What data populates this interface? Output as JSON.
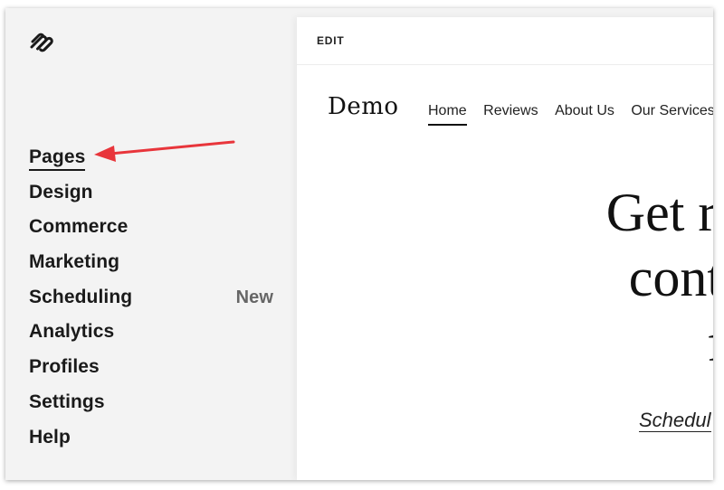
{
  "sidebar": {
    "logo_icon": "squarespace-logo-icon",
    "items": [
      {
        "label": "Pages",
        "active": true
      },
      {
        "label": "Design"
      },
      {
        "label": "Commerce"
      },
      {
        "label": "Marketing"
      },
      {
        "label": "Scheduling",
        "badge": "New"
      },
      {
        "label": "Analytics"
      },
      {
        "label": "Profiles"
      },
      {
        "label": "Settings"
      },
      {
        "label": "Help"
      }
    ]
  },
  "annotation": {
    "arrow_color": "#e8353b"
  },
  "preview": {
    "edit_label": "EDIT",
    "site_title": "Demo",
    "nav": [
      "Home",
      "Reviews",
      "About Us",
      "Our Services"
    ],
    "hero_lines": [
      "Get re",
      "contr",
      "fi"
    ],
    "cta": "Schedul"
  }
}
